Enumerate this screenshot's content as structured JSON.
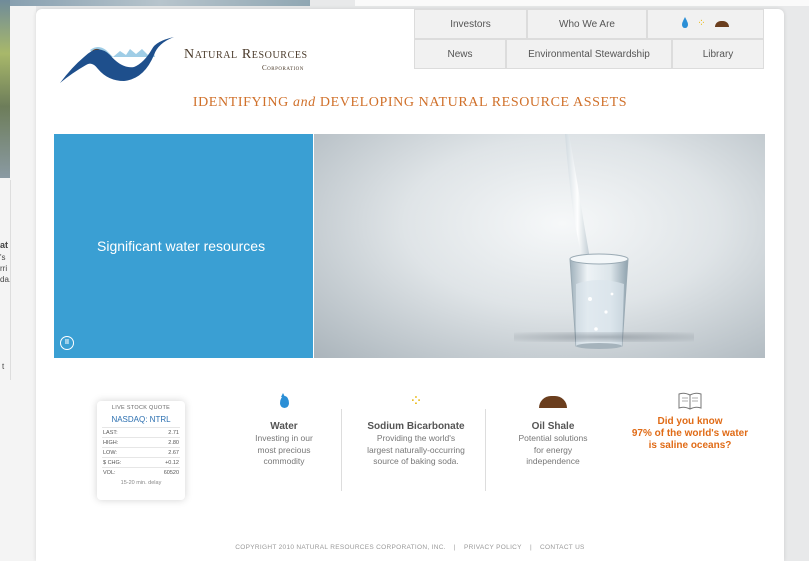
{
  "background": {
    "text_fragments": [
      "at",
      "'s",
      "rri",
      "da.",
      "t"
    ]
  },
  "logo": {
    "name": "Natural Resources",
    "subtitle": "Corporation"
  },
  "nav": {
    "row1": [
      "Investors",
      "Who We Are"
    ],
    "row2": [
      "News",
      "Environmental Stewardship",
      "Library"
    ],
    "icons": [
      "water-drop-icon",
      "bicarbonate-dots-icon",
      "oil-shale-mound-icon"
    ]
  },
  "tagline": {
    "before": "IDENTIFYING ",
    "connector": "and",
    "after": " DEVELOPING NATURAL RESOURCE ASSETS"
  },
  "hero": {
    "caption": "Significant water resources",
    "pause_icon": "pause-icon"
  },
  "stock": {
    "title": "LIVE STOCK QUOTE",
    "symbol": "NASDAQ: NTRL",
    "rows": [
      {
        "label": "LAST:",
        "value": "2.71"
      },
      {
        "label": "HIGH:",
        "value": "2.80"
      },
      {
        "label": "LOW:",
        "value": "2.67"
      },
      {
        "label": "$ CHG:",
        "value": "+0.12"
      },
      {
        "label": "VOL:",
        "value": "60520"
      }
    ],
    "delay": "15-20 min. delay"
  },
  "features": [
    {
      "title": "Water",
      "lines": [
        "Investing in our",
        "most precious",
        "commodity"
      ],
      "icon": "water-drop-icon"
    },
    {
      "title": "Sodium Bicarbonate",
      "lines": [
        "Providing the world's",
        "largest naturally-occurring",
        "source of baking soda."
      ],
      "icon": "bicarbonate-dots-icon"
    },
    {
      "title": "Oil Shale",
      "lines": [
        "Potential solutions",
        "for energy",
        "independence"
      ],
      "icon": "oil-shale-mound-icon"
    }
  ],
  "did_you_know": {
    "line1": "Did you know",
    "line2": "97% of the world's water",
    "line3": "is saline oceans?",
    "icon": "book-icon"
  },
  "footer": {
    "copyright": "COPYRIGHT 2010 NATURAL RESOURCES CORPORATION, INC.",
    "sep": "|",
    "privacy": "PRIVACY POLICY",
    "contact": "CONTACT US"
  },
  "colors": {
    "accent_blue": "#3a9fd3",
    "tagline_orange": "#d0702a",
    "highlight_orange": "#e06b16",
    "earth_brown": "#6b3e1e",
    "navy_logo": "#1e4f8c"
  }
}
